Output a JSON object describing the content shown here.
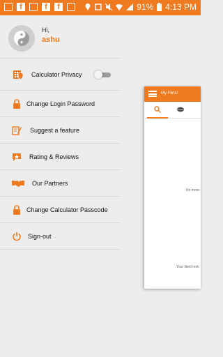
{
  "status_bar": {
    "battery": "91%",
    "time": "4:13 PM"
  },
  "profile": {
    "greeting": "Hi,",
    "username": "ashu"
  },
  "menu": {
    "calculator_privacy": "Calculator Privacy",
    "change_login_password": "Change Login Password",
    "suggest_feature": "Suggest a feature",
    "rating_reviews": "Rating & Reviews",
    "our_partners": "Our Partners",
    "change_calculator_passcode": "Change Calculator Passcode",
    "sign_out": "Sign-out"
  },
  "preview": {
    "title": "My Flirts!",
    "empty_text_1": "No more",
    "empty_text_2": "Your liked now"
  },
  "colors": {
    "accent": "#f07a1f",
    "background": "#ededed"
  }
}
